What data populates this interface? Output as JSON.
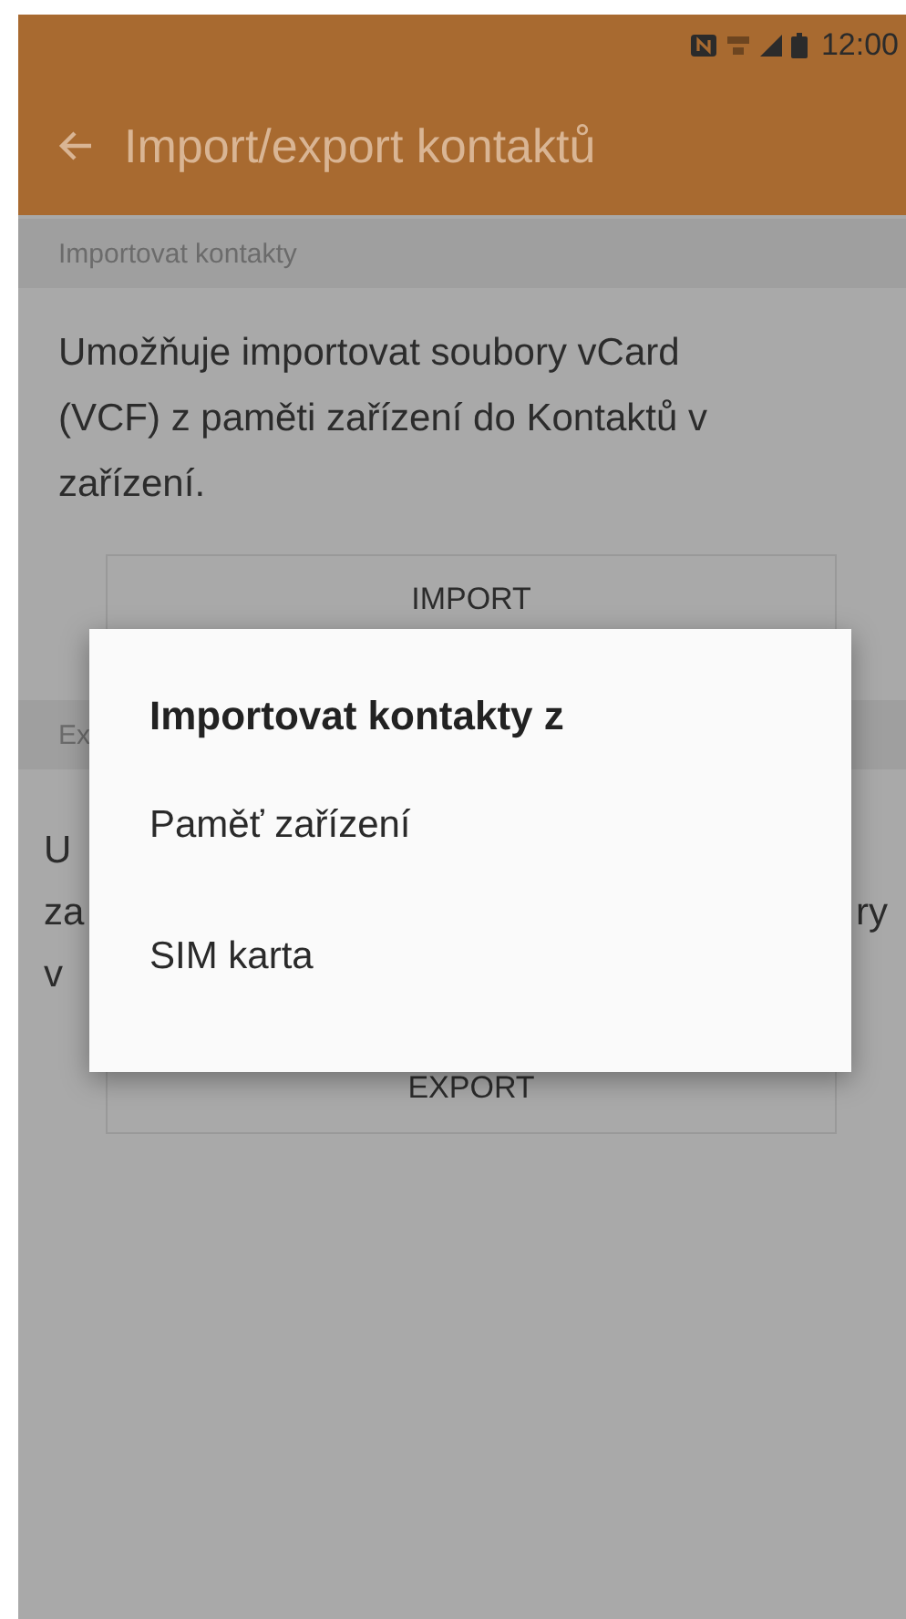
{
  "status_bar": {
    "time": "12:00"
  },
  "toolbar": {
    "title": "Import/export kontaktů"
  },
  "import_section": {
    "header": "Importovat kontakty",
    "description": "Umožňuje importovat soubory vCard (VCF) z paměti zařízení do Kontaktů v zařízení.",
    "button": "IMPORT"
  },
  "export_section": {
    "header": "Ex",
    "description_left": [
      "U",
      "za",
      "v"
    ],
    "description_right": [
      "ry"
    ],
    "button": "EXPORT"
  },
  "dialog": {
    "title": "Importovat kontakty z",
    "options": [
      {
        "label": "Paměť zařízení"
      },
      {
        "label": "SIM karta"
      }
    ]
  }
}
